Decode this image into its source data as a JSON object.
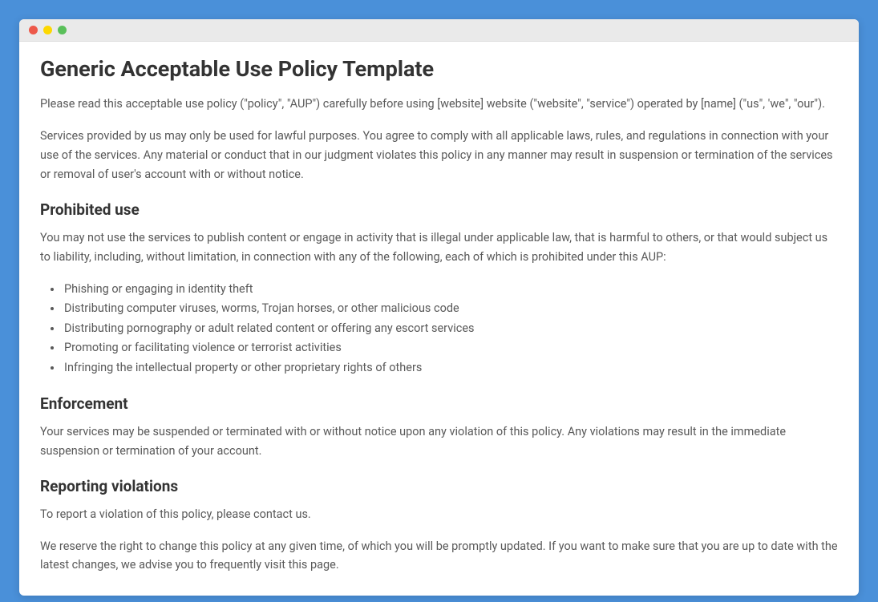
{
  "title": "Generic Acceptable Use Policy Template",
  "intro": {
    "p1": "Please read this acceptable use policy (\"policy\", \"AUP\") carefully before using [website] website (\"website\", \"service\") operated by [name] (\"us\", 'we\", \"our\").",
    "p2": "Services provided by us may only be used for lawful purposes. You agree to comply with all applicable laws, rules, and regulations in connection with your use of the services. Any material or conduct that in our judgment violates this policy in any manner may result in suspension or termination of the services or removal of user's account with or without notice."
  },
  "sections": {
    "prohibited": {
      "heading": "Prohibited use",
      "p1": "You may not use the services to publish content or engage in activity that is illegal under applicable law, that is harmful to others, or that would subject us to liability, including, without limitation, in connection with any of the following, each of which is prohibited under this AUP:",
      "bullets": [
        "Phishing or engaging in identity theft",
        "Distributing computer viruses, worms, Trojan horses, or other malicious code",
        "Distributing pornography or adult related content or offering any escort services",
        "Promoting or facilitating violence or terrorist activities",
        "Infringing the intellectual property or other proprietary rights of others"
      ]
    },
    "enforcement": {
      "heading": "Enforcement",
      "p1": "Your services may be suspended or terminated with or without notice upon any violation of this policy. Any violations may result in the immediate suspension or termination of your account."
    },
    "reporting": {
      "heading": "Reporting violations",
      "p1": "To report a violation of this policy, please contact us.",
      "p2": "We reserve the right to change this policy at any given time, of which you will be promptly updated. If you want to make sure that you are up to date with the latest changes, we advise you to frequently visit this page."
    }
  }
}
